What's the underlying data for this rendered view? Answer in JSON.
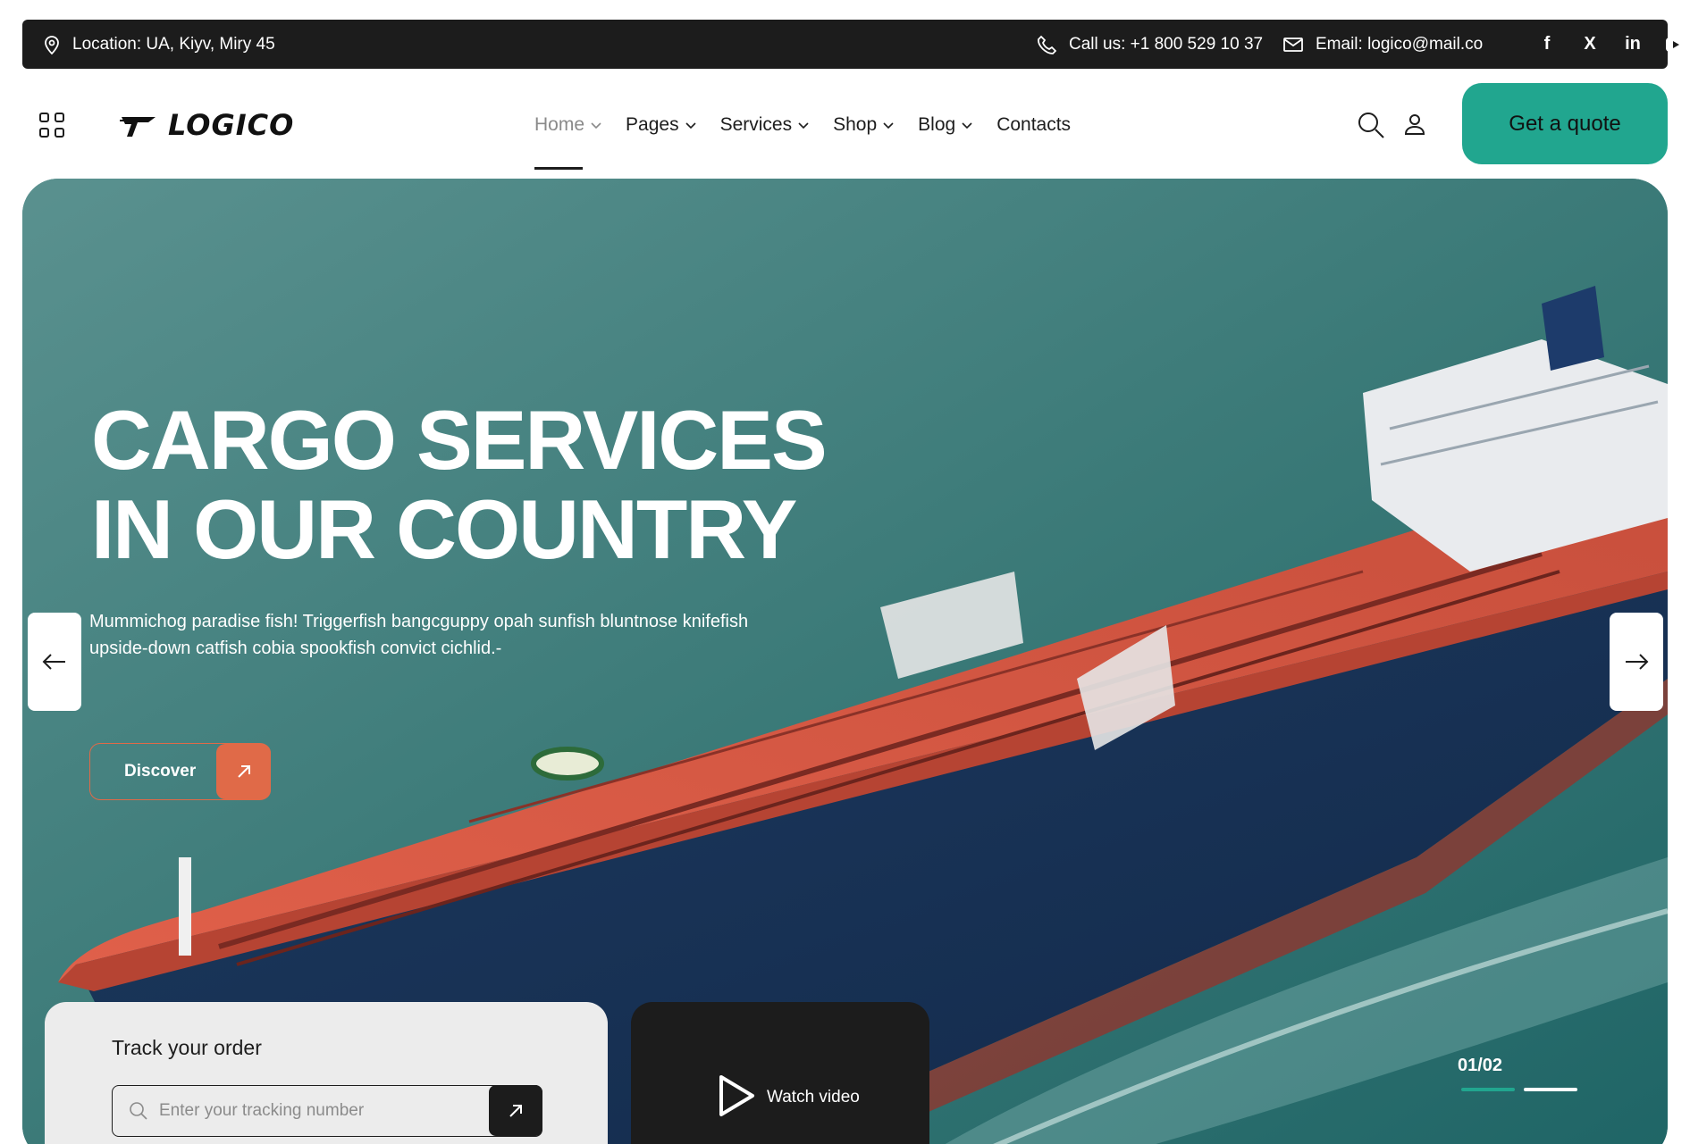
{
  "colors": {
    "topbar_bg": "#1c1c1c",
    "accent_teal": "#21a68f",
    "accent_orange": "#e06a48",
    "ship_hull_deck": "#d2553f",
    "ship_hull_side": "#1e3a5c"
  },
  "topbar": {
    "location": "Location: UA, Kiyv, Miry 45",
    "phone": "Call us: +1 800 529 10 37",
    "email": "Email: logico@mail.co",
    "social": [
      "f",
      "X",
      "in",
      "youtube"
    ]
  },
  "header": {
    "logo_text": "LOGICO",
    "nav": [
      {
        "label": "Home",
        "dropdown": true,
        "active": true
      },
      {
        "label": "Pages",
        "dropdown": true
      },
      {
        "label": "Services",
        "dropdown": true
      },
      {
        "label": "Shop",
        "dropdown": true
      },
      {
        "label": "Blog",
        "dropdown": true
      },
      {
        "label": "Contacts",
        "dropdown": false
      }
    ],
    "cta_label": "Get a quote"
  },
  "hero": {
    "title_line1": "CARGO SERVICES",
    "title_line2": "IN OUR COUNTRY",
    "description": "Mummichog paradise fish! Triggerfish bangcguppy opah sunfish bluntnose knifefish upside-down catfish cobia spookfish convict cichlid.-",
    "discover_label": "Discover",
    "slide_counter": "01/02",
    "slide_progress": 0.5
  },
  "track": {
    "title": "Track your order",
    "placeholder": "Enter your tracking number",
    "value": ""
  },
  "video": {
    "label": "Watch video"
  }
}
